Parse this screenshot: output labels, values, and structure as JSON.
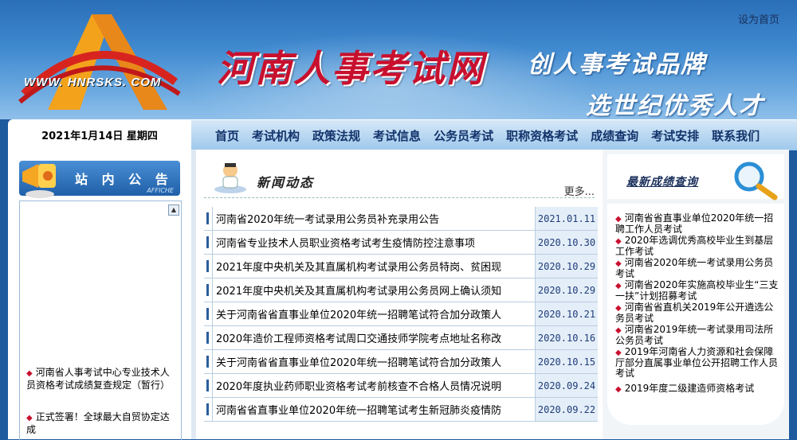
{
  "header": {
    "logo_url": "WWW. HNRSKS. COM",
    "site_title": "河南人事考试网",
    "slogan_line1": "创人事考试品牌",
    "slogan_line2": "选世纪优秀人才",
    "set_home": "设为首页"
  },
  "date": "2021年1月14日 星期四",
  "nav": {
    "items": [
      "首页",
      "考试机构",
      "政策法规",
      "考试信息",
      "公务员考试",
      "职称资格考试",
      "成绩查询",
      "考试安排",
      "联系我们"
    ]
  },
  "notice": {
    "title": "站 内 公 告",
    "subtitle": "AFFICHE",
    "items": [
      "河南省人事考试中心专业技术人员资格考试成绩复查规定（暂行）",
      "正式签署！全球最大自贸协定达成"
    ]
  },
  "news": {
    "title": "新闻动态",
    "more": "更多...",
    "rows": [
      {
        "title": "河南省2020年统一考试录用公务员补充录用公告",
        "date": "2021.01.11"
      },
      {
        "title": "河南省专业技术人员职业资格考试考生疫情防控注意事项",
        "date": "2020.10.30"
      },
      {
        "title": "2021年度中央机关及其直属机构考试录用公务员特岗、贫困现",
        "date": "2020.10.29"
      },
      {
        "title": "2021年度中央机关及其直属机构考试录用公务员网上确认须知",
        "date": "2020.10.29"
      },
      {
        "title": "关于河南省省直事业单位2020年统一招聘笔试符合加分政策人",
        "date": "2020.10.21"
      },
      {
        "title": "2020年造价工程师资格考试周口交通技师学院考点地址名称改",
        "date": "2020.10.16"
      },
      {
        "title": "关于河南省省直事业单位2020年统一招聘笔试符合加分政策人",
        "date": "2020.10.15"
      },
      {
        "title": "2020年度执业药师职业资格考试考前核查不合格人员情况说明",
        "date": "2020.09.24"
      },
      {
        "title": "河南省省直事业单位2020年统一招聘笔试考生新冠肺炎疫情防",
        "date": "2020.09.22"
      }
    ]
  },
  "scores": {
    "title": "最新成绩查询",
    "items": [
      "河南省省直事业单位2020年统一招聘工作人员考试",
      "2020年选调优秀高校毕业生到基层工作考试",
      "河南省2020年统一考试录用公务员考试",
      "河南省2020年实施高校毕业生“三支一扶”计划招募考试",
      "河南省省直机关2019年公开遴选公务员考试",
      "河南省2019年统一考试录用司法所公务员考试",
      "2019年河南省人力资源和社会保障厅部分直属事业单位公开招聘工作人员考试",
      "2019年度二级建造师资格考试"
    ]
  },
  "colors": {
    "title_red": "#c8102e",
    "nav_text": "#13336b",
    "banner_blue": "#2a6fb8"
  }
}
